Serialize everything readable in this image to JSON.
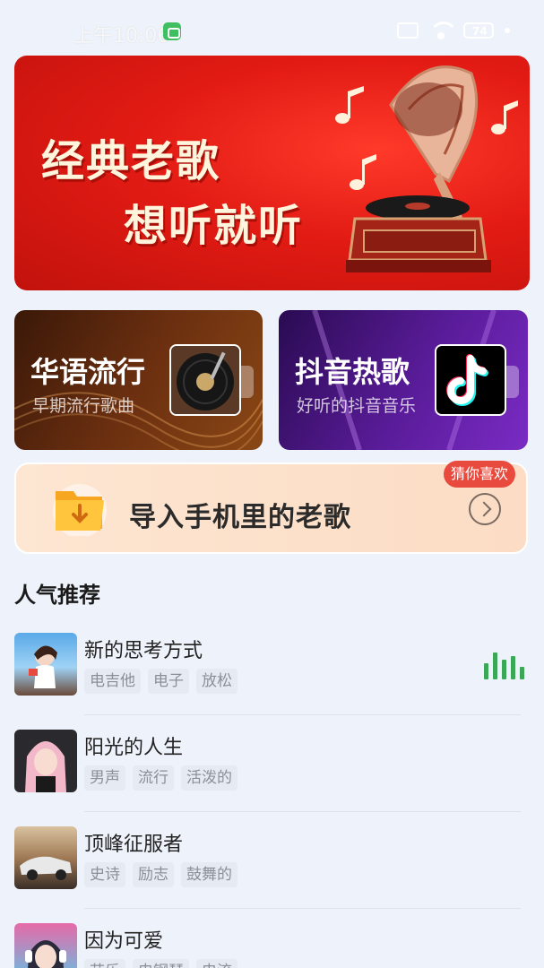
{
  "status_bar": {
    "time": "上午10:06",
    "battery": "74"
  },
  "banner": {
    "line1": "经典老歌",
    "line2": "想听就听"
  },
  "cards": [
    {
      "title": "华语流行",
      "subtitle": "早期流行歌曲"
    },
    {
      "title": "抖音热歌",
      "subtitle": "好听的抖音音乐"
    }
  ],
  "import": {
    "label": "导入手机里的老歌",
    "badge": "猜你喜欢"
  },
  "section": {
    "title": "人气推荐"
  },
  "songs": [
    {
      "title": "新的思考方式",
      "tags": [
        "电吉他",
        "电子",
        "放松"
      ],
      "playing": true
    },
    {
      "title": "阳光的人生",
      "tags": [
        "男声",
        "流行",
        "活泼的"
      ]
    },
    {
      "title": "顶峰征服者",
      "tags": [
        "史诗",
        "励志",
        "鼓舞的"
      ]
    },
    {
      "title": "因为可爱",
      "tags": [
        "节乐",
        "电钢琴",
        "电流"
      ]
    }
  ],
  "colors": {
    "accent_green": "#3aa856",
    "badge_red": "#e84a3e",
    "banner_red": "#e21b14"
  }
}
